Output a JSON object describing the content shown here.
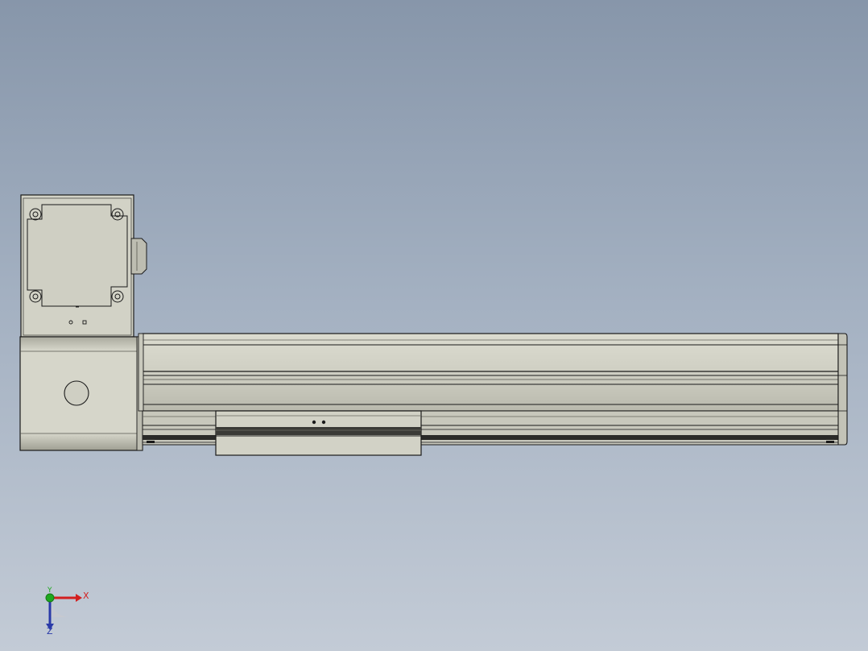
{
  "viewport": {
    "background_top": "#8796aa",
    "background_bottom": "#c3cbd6"
  },
  "model": {
    "description_icon": "linear-actuator-model",
    "body_fill": "#d1d1c5",
    "shade_fill": "#b8b8ac",
    "edge_color": "#1a1a1a"
  },
  "triad": {
    "x_label": "X",
    "y_label": "Y",
    "z_label": "Z",
    "x_color": "#d31f1f",
    "y_color": "#1ea81e",
    "z_color": "#2a3aa8"
  }
}
